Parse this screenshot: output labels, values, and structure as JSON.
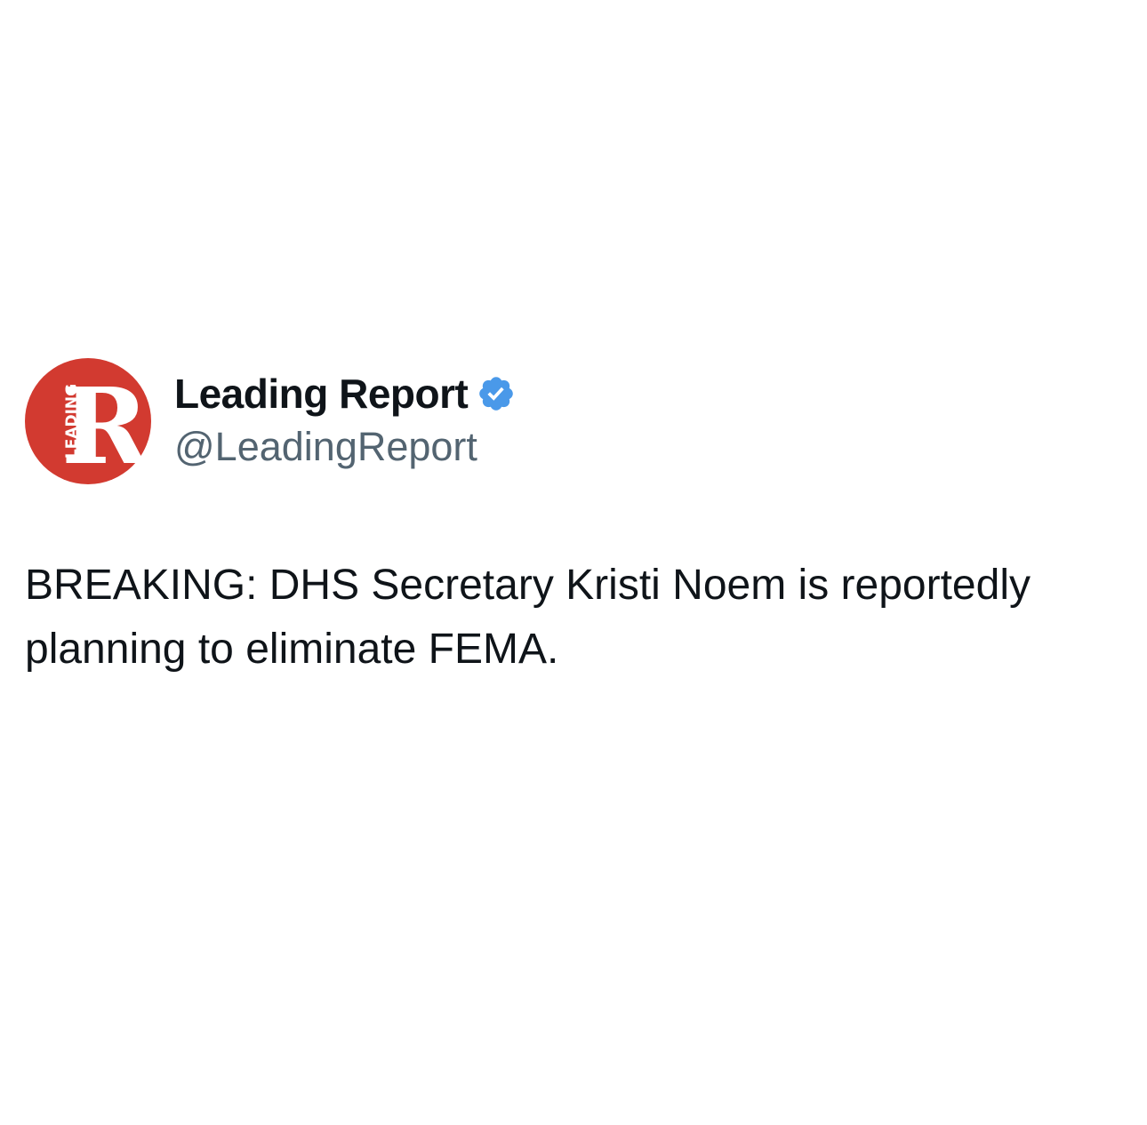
{
  "account": {
    "display_name": "Leading Report",
    "handle": "@LeadingReport",
    "verified_badge_icon": "verified-checkmark-icon",
    "verified_badge_color": "#4a99e9",
    "avatar": {
      "logo_letter": "R",
      "logo_word": "LEADING",
      "background_color": "#d23a30"
    }
  },
  "tweet": {
    "text": "BREAKING: DHS Secretary Kristi Noem is reportedly planning to eliminate FEMA."
  }
}
